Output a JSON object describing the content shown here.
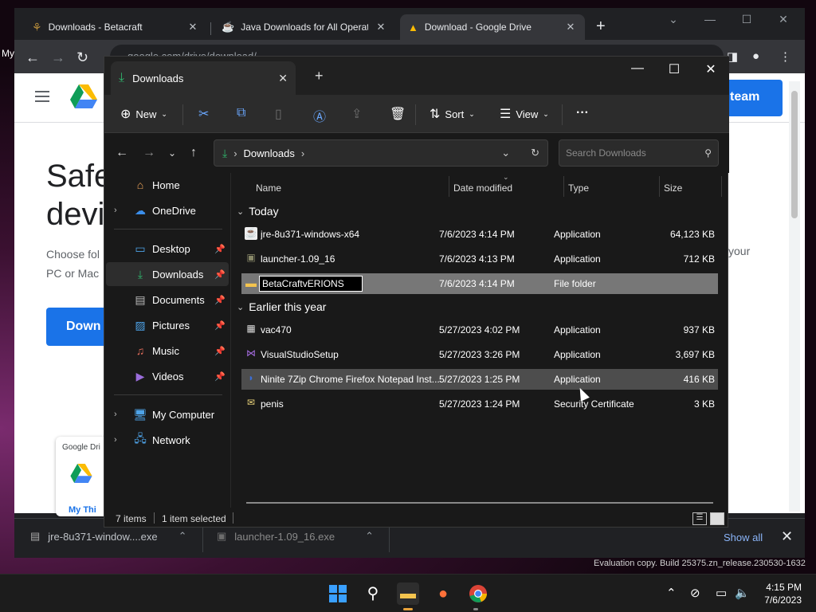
{
  "browser": {
    "tabs": [
      {
        "title": "Downloads - Betacraft"
      },
      {
        "title": "Java Downloads for All Operating Systems"
      },
      {
        "title": "Download - Google Drive"
      }
    ],
    "omnibox_url": "google.com/drive/download/",
    "page": {
      "hero_line1": "Safe",
      "hero_line2": "devi",
      "sub_line1": "Choose fol",
      "sub_line2": "PC or Mac",
      "sub_right": "your",
      "download_btn": "Down",
      "team_btn": "team",
      "card_title": "Google Dri",
      "card_link": "My Thi"
    },
    "shelf": {
      "items": [
        {
          "name": "jre-8u371-window....exe"
        },
        {
          "name": "launcher-1.09_16.exe"
        }
      ],
      "show_all": "Show all"
    },
    "left_edge_text": "My"
  },
  "explorer": {
    "tab_title": "Downloads",
    "commands": {
      "new": "New",
      "sort": "Sort",
      "view": "View",
      "more": "···"
    },
    "address": {
      "path": "Downloads"
    },
    "search": {
      "placeholder": "Search Downloads"
    },
    "nav": {
      "home": "Home",
      "onedrive": "OneDrive",
      "desktop": "Desktop",
      "downloads": "Downloads",
      "documents": "Documents",
      "pictures": "Pictures",
      "music": "Music",
      "videos": "Videos",
      "my_computer": "My Computer",
      "network": "Network"
    },
    "columns": {
      "name": "Name",
      "date": "Date modified",
      "type": "Type",
      "size": "Size"
    },
    "groups": {
      "today": "Today",
      "earlier": "Earlier this year"
    },
    "files": [
      {
        "name": "jre-8u371-windows-x64",
        "date": "7/6/2023 4:14 PM",
        "type": "Application",
        "size": "64,123 KB"
      },
      {
        "name": "launcher-1.09_16",
        "date": "7/6/2023 4:13 PM",
        "type": "Application",
        "size": "712 KB"
      },
      {
        "name": "BetaCraftvERIONS",
        "date": "7/6/2023 4:14 PM",
        "type": "File folder",
        "size": ""
      },
      {
        "name": "vac470",
        "date": "5/27/2023 4:02 PM",
        "type": "Application",
        "size": "937 KB"
      },
      {
        "name": "VisualStudioSetup",
        "date": "5/27/2023 3:26 PM",
        "type": "Application",
        "size": "3,697 KB"
      },
      {
        "name": "Ninite 7Zip Chrome Firefox Notepad Inst...",
        "date": "5/27/2023 1:25 PM",
        "type": "Application",
        "size": "416 KB"
      },
      {
        "name": "penis",
        "date": "5/27/2023 1:24 PM",
        "type": "Security Certificate",
        "size": "3 KB"
      }
    ],
    "status": {
      "count": "7 items",
      "selected": "1 item selected"
    }
  },
  "desktop": {
    "eval_text": "Evaluation copy. Build 25375.zn_release.230530-1632",
    "clock_time": "4:15 PM",
    "clock_date": "7/6/2023"
  },
  "colors": {
    "accent_blue": "#1a73e8",
    "folder_yellow": "#f4c44e",
    "download_green": "#2fb36b"
  }
}
